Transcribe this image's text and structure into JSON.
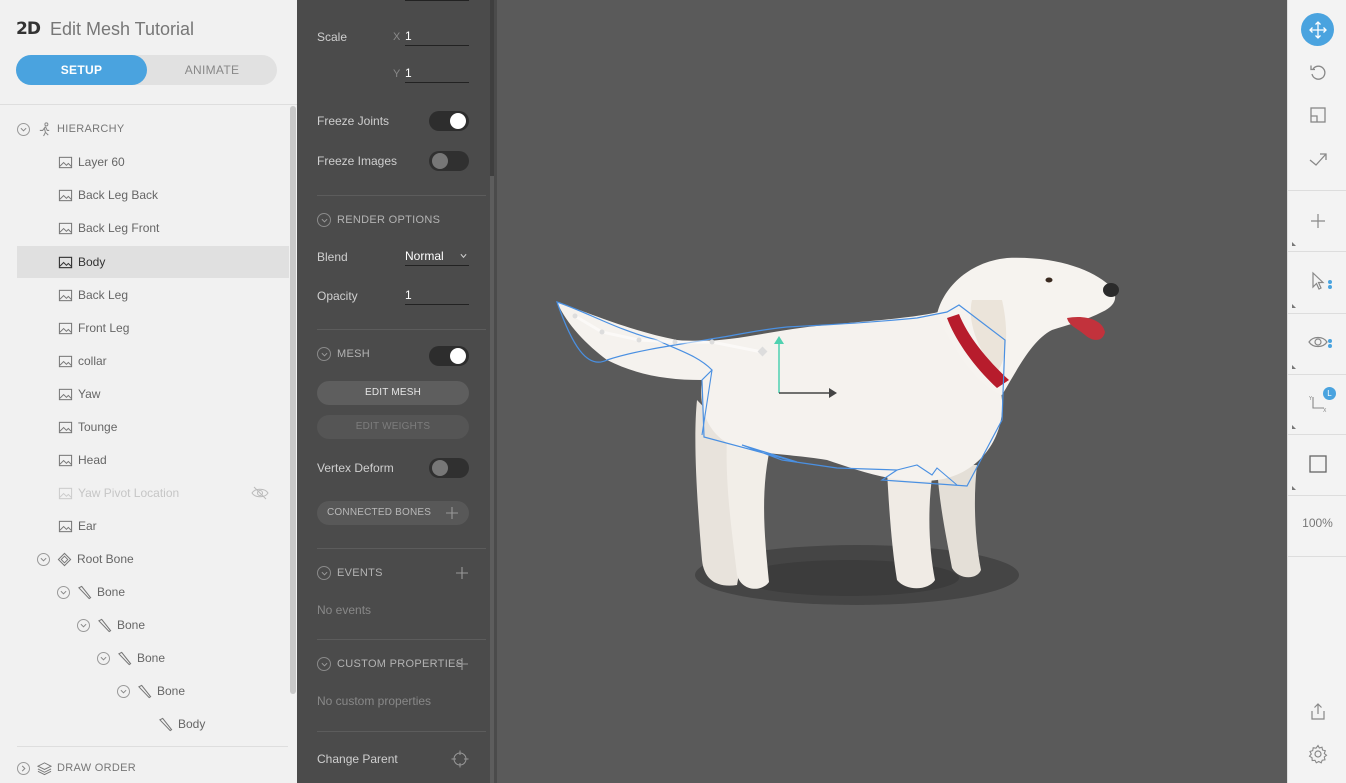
{
  "app": {
    "logo": "2D",
    "title": "Edit Mesh Tutorial"
  },
  "mode": {
    "setup": "SETUP",
    "animate": "ANIMATE",
    "active": "SETUP"
  },
  "hierarchy": {
    "header": "HIERARCHY",
    "items": [
      {
        "label": "Layer 60",
        "type": "image"
      },
      {
        "label": "Back Leg Back",
        "type": "image"
      },
      {
        "label": "Back Leg Front",
        "type": "image"
      },
      {
        "label": "Body",
        "type": "image",
        "selected": true
      },
      {
        "label": "Back Leg",
        "type": "image"
      },
      {
        "label": "Front Leg",
        "type": "image"
      },
      {
        "label": "collar",
        "type": "image"
      },
      {
        "label": "Yaw",
        "type": "image"
      },
      {
        "label": "Tounge",
        "type": "image"
      },
      {
        "label": "Head",
        "type": "image"
      },
      {
        "label": "Yaw Pivot Location",
        "type": "image",
        "hidden": true
      },
      {
        "label": "Ear",
        "type": "image"
      },
      {
        "label": "Root Bone",
        "type": "root-bone"
      },
      {
        "label": "Bone",
        "type": "bone"
      },
      {
        "label": "Bone",
        "type": "bone"
      },
      {
        "label": "Bone",
        "type": "bone"
      },
      {
        "label": "Bone",
        "type": "bone"
      },
      {
        "label": "Body",
        "type": "bone-leaf"
      }
    ],
    "draw_order": "DRAW ORDER"
  },
  "properties": {
    "scale_label": "Scale",
    "scale_x_axis": "X",
    "scale_x": "1",
    "scale_y_axis": "Y",
    "scale_y": "1",
    "freeze_joints": "Freeze Joints",
    "freeze_joints_on": true,
    "freeze_images": "Freeze Images",
    "freeze_images_on": false,
    "render_options": "RENDER OPTIONS",
    "blend_label": "Blend",
    "blend_value": "Normal",
    "opacity_label": "Opacity",
    "opacity_value": "1",
    "mesh_label": "MESH",
    "mesh_on": true,
    "edit_mesh": "EDIT MESH",
    "edit_weights": "EDIT WEIGHTS",
    "vertex_deform": "Vertex Deform",
    "vertex_deform_on": false,
    "connected_bones": "CONNECTED BONES",
    "events": "EVENTS",
    "no_events": "No events",
    "custom_properties": "CUSTOM PROPERTIES",
    "no_custom_properties": "No custom properties",
    "change_parent": "Change Parent"
  },
  "toolbar": {
    "tools": [
      "move-icon",
      "rotate-icon",
      "scale-icon",
      "translate-arrow-icon",
      "add-icon",
      "select-pointer-icon",
      "visibility-eye-icon",
      "local-axis-icon",
      "frame-icon",
      "export-icon",
      "settings-gear-icon"
    ],
    "local_badge": "L",
    "zoom": "100%"
  },
  "colors": {
    "accent": "#4aa3df",
    "left_panel": "#f1f1f1",
    "props_panel": "#4b4b4b",
    "stage": "#5a5a5a",
    "mesh_outline": "#4a90e2",
    "bone_axis_y": "#4fd1b0",
    "collar": "#b71c2c"
  }
}
